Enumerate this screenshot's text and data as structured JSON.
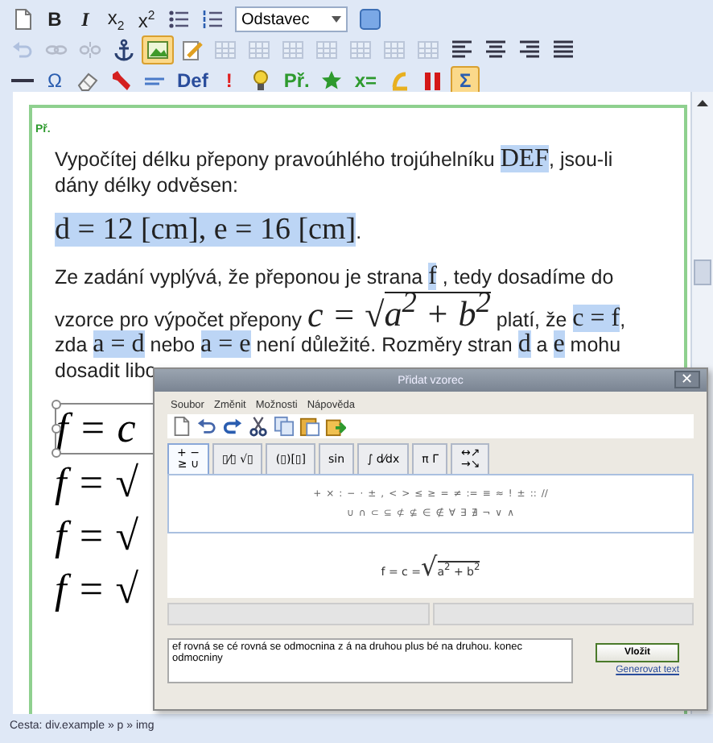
{
  "toolbar": {
    "rows": [
      [
        {
          "kind": "icon",
          "disabled": false,
          "active": false
        },
        {
          "kind": "bold",
          "label": "B",
          "color": "#222222",
          "disabled": false,
          "active": false
        },
        {
          "kind": "italic",
          "label": "I",
          "color": "#222222",
          "disabled": false,
          "active": false
        },
        {
          "kind": "text",
          "label": "x$_{2}$",
          "color": "#222222",
          "disabled": false,
          "active": false
        },
        {
          "kind": "text",
          "label": "x$^{2}$",
          "color": "#222222",
          "disabled": false,
          "active": false
        },
        {
          "kind": "icon",
          "disabled": false,
          "active": false
        },
        {
          "kind": "icon",
          "disabled": false,
          "active": false
        },
        {
          "kind": "dropdown",
          "label": "Odstavec"
        },
        {
          "kind": "icon",
          "disabled": false,
          "active": false
        }
      ],
      [
        {
          "kind": "icon",
          "disabled": true,
          "active": false
        },
        {
          "kind": "icon",
          "disabled": true,
          "active": false
        },
        {
          "kind": "icon",
          "disabled": true,
          "active": false
        },
        {
          "kind": "icon",
          "disabled": false,
          "active": false
        },
        {
          "kind": "icon",
          "disabled": false,
          "active": true
        },
        {
          "kind": "icon",
          "disabled": false,
          "active": false
        },
        {
          "kind": "icon",
          "disabled": true,
          "active": false
        },
        {
          "kind": "icon",
          "disabled": true,
          "active": false
        },
        {
          "kind": "icon",
          "disabled": true,
          "active": false
        },
        {
          "kind": "icon",
          "disabled": true,
          "active": false
        },
        {
          "kind": "icon",
          "disabled": true,
          "active": false
        },
        {
          "kind": "icon",
          "disabled": true,
          "active": false
        },
        {
          "kind": "icon",
          "disabled": true,
          "active": false
        },
        {
          "kind": "icon",
          "disabled": false,
          "active": false
        },
        {
          "kind": "icon",
          "disabled": false,
          "active": false
        },
        {
          "kind": "icon",
          "disabled": false,
          "active": false
        },
        {
          "kind": "icon",
          "disabled": false,
          "active": false
        }
      ],
      [
        {
          "kind": "icon",
          "disabled": false,
          "active": false
        },
        {
          "kind": "text",
          "label": "Ω",
          "color": "#2a5db0",
          "disabled": false,
          "active": false
        },
        {
          "kind": "icon",
          "disabled": false,
          "active": false
        },
        {
          "kind": "icon",
          "disabled": false,
          "active": false
        },
        {
          "kind": "icon",
          "disabled": false,
          "active": false
        },
        {
          "kind": "bold",
          "label": "Def",
          "color": "#2a4d9c",
          "disabled": false,
          "active": false
        },
        {
          "kind": "bold",
          "label": "!",
          "color": "#e02020",
          "disabled": false,
          "active": false
        },
        {
          "kind": "icon",
          "disabled": false,
          "active": false
        },
        {
          "kind": "bold",
          "label": "Př.",
          "color": "#2e9a2e",
          "disabled": false,
          "active": false
        },
        {
          "kind": "icon",
          "disabled": false,
          "active": false
        },
        {
          "kind": "bold",
          "label": "x=",
          "color": "#2e9a2e",
          "disabled": false,
          "active": false
        },
        {
          "kind": "icon",
          "disabled": false,
          "active": false
        },
        {
          "kind": "icon",
          "disabled": false,
          "active": false
        },
        {
          "kind": "bold",
          "label": "Σ",
          "color": "#2a5db0",
          "disabled": false,
          "active": true
        }
      ]
    ]
  },
  "editor": {
    "block_label": "Př.",
    "paragraphs": [
      [
        {
          "kind": "text",
          "text": "Vypočítej délku přepony pravoúhlého trojúhelníku "
        },
        {
          "kind": "math",
          "text": "DEF"
        },
        {
          "kind": "text",
          "text": ", jsou-li dány délky odvěsen:"
        }
      ],
      [
        {
          "kind": "math",
          "text": "d = 12 [cm], e = 16 [cm]"
        },
        {
          "kind": "text",
          "text": "."
        }
      ],
      [
        {
          "kind": "text",
          "text": "Ze zadání vyplývá, že přeponou je strana "
        },
        {
          "kind": "math",
          "text": "f"
        },
        {
          "kind": "text",
          "text": " , tedy dosadíme do vzorce pro výpočet přepony "
        },
        {
          "kind": "sqrt",
          "lhs": "c =",
          "sign": "√",
          "radicand": "a$^{2}$ + b$^{2}$"
        },
        {
          "kind": "text",
          "text": " platí, že "
        },
        {
          "kind": "math",
          "text": "c = f"
        },
        {
          "kind": "text",
          "text": ", zda "
        },
        {
          "kind": "math",
          "text": "a = d"
        },
        {
          "kind": "text",
          "text": " nebo "
        },
        {
          "kind": "math",
          "text": "a = e"
        },
        {
          "kind": "text",
          "text": " není důležité. Rozměry stran "
        },
        {
          "kind": "math",
          "text": "d"
        },
        {
          "kind": "text",
          "text": " a "
        },
        {
          "kind": "math",
          "text": "e"
        },
        {
          "kind": "text",
          "text": " mohu dosadit libo"
        }
      ]
    ],
    "formulas": [
      {
        "text": "f = c",
        "selected": true
      },
      {
        "text": "f = √",
        "selected": false
      },
      {
        "text": "f = √",
        "selected": false
      },
      {
        "text": "f = √",
        "selected": false
      }
    ]
  },
  "status_bar": "Cesta: div.example » p » img",
  "dialog": {
    "title": "Přidat vzorec",
    "close": "✕",
    "menu": [
      "Soubor",
      "Změnit",
      "Možnosti",
      "Nápověda"
    ],
    "tabs": [
      {
        "label": "+ −\n≥ ∪",
        "selected": true
      },
      {
        "label": "▯⁄▯ √▯",
        "selected": false
      },
      {
        "label": "(▯)[▯]",
        "selected": false
      },
      {
        "label": "sin",
        "selected": false
      },
      {
        "label": "∫ d⁄dx",
        "selected": false
      },
      {
        "label": "π Γ",
        "selected": false
      },
      {
        "label": "↔↗\n→↘",
        "selected": false
      }
    ],
    "symbol_rows": [
      [
        "+",
        "×",
        ":",
        "−",
        "·",
        "±",
        ",",
        "<",
        ">",
        "≤",
        "≥",
        "=",
        "≠",
        ":=",
        "≡",
        "≈",
        "!",
        "±",
        "::",
        "//"
      ],
      [
        "∪",
        "∩",
        "⊂",
        "⊆",
        "⊄",
        "⊈",
        "∈",
        "∉",
        "∀",
        "∃",
        "∄",
        "¬",
        "∨",
        "∧"
      ]
    ],
    "preview": {
      "lhs": "f = c =",
      "sign": "√",
      "radicand": "a$^{2}$ + b$^{2}$"
    },
    "spoken_text": "ef rovná se cé rovná se odmocnina z á na druhou plus bé na druhou. konec odmocniny",
    "insert_button": "Vložit",
    "generate_link": "Generovat text"
  }
}
